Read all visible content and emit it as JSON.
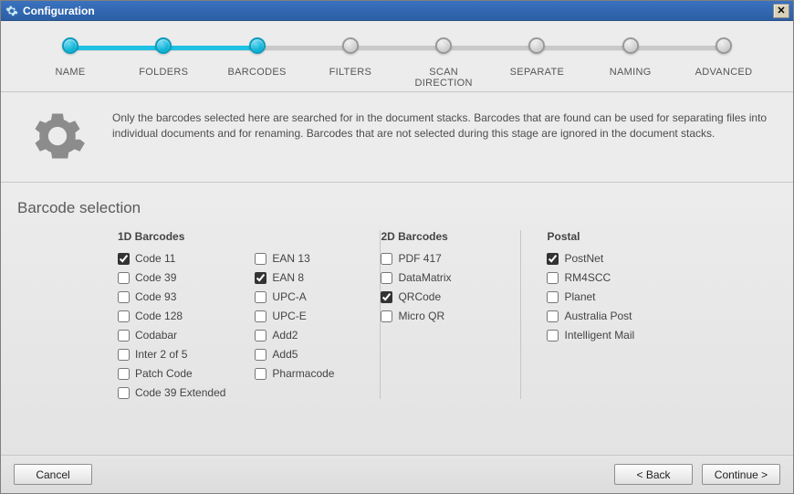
{
  "window": {
    "title": "Configuration",
    "close_glyph": "✕"
  },
  "steps": [
    {
      "label": "NAME",
      "state": "completed"
    },
    {
      "label": "FOLDERS",
      "state": "completed"
    },
    {
      "label": "BARCODES",
      "state": "active"
    },
    {
      "label": "FILTERS",
      "state": "pending"
    },
    {
      "label": "SCAN\nDIRECTION",
      "state": "pending"
    },
    {
      "label": "SEPARATE",
      "state": "pending"
    },
    {
      "label": "NAMING",
      "state": "pending"
    },
    {
      "label": "ADVANCED",
      "state": "pending"
    }
  ],
  "info": {
    "text": "Only the barcodes selected here are searched for in the document stacks. Barcodes that are found can be used for separating files into individual documents and for renaming. Barcodes that are not selected during this stage are ignored in the document stacks."
  },
  "section": {
    "title": "Barcode selection"
  },
  "groups": {
    "one_d": {
      "header": "1D Barcodes",
      "left": [
        {
          "label": "Code 11",
          "checked": true
        },
        {
          "label": "Code 39",
          "checked": false
        },
        {
          "label": "Code 93",
          "checked": false
        },
        {
          "label": "Code 128",
          "checked": false
        },
        {
          "label": "Codabar",
          "checked": false
        },
        {
          "label": "Inter 2 of 5",
          "checked": false
        },
        {
          "label": "Patch Code",
          "checked": false
        },
        {
          "label": "Code 39 Extended",
          "checked": false
        }
      ],
      "right": [
        {
          "label": "EAN 13",
          "checked": false
        },
        {
          "label": "EAN 8",
          "checked": true
        },
        {
          "label": "UPC-A",
          "checked": false
        },
        {
          "label": "UPC-E",
          "checked": false
        },
        {
          "label": "Add2",
          "checked": false
        },
        {
          "label": "Add5",
          "checked": false
        },
        {
          "label": "Pharmacode",
          "checked": false
        }
      ]
    },
    "two_d": {
      "header": "2D Barcodes",
      "items": [
        {
          "label": "PDF 417",
          "checked": false
        },
        {
          "label": "DataMatrix",
          "checked": false
        },
        {
          "label": "QRCode",
          "checked": true
        },
        {
          "label": "Micro QR",
          "checked": false
        }
      ]
    },
    "postal": {
      "header": "Postal",
      "items": [
        {
          "label": "PostNet",
          "checked": true
        },
        {
          "label": "RM4SCC",
          "checked": false
        },
        {
          "label": "Planet",
          "checked": false
        },
        {
          "label": "Australia Post",
          "checked": false
        },
        {
          "label": "Intelligent Mail",
          "checked": false
        }
      ]
    }
  },
  "buttons": {
    "cancel": "Cancel",
    "back": "< Back",
    "continue": "Continue >"
  }
}
